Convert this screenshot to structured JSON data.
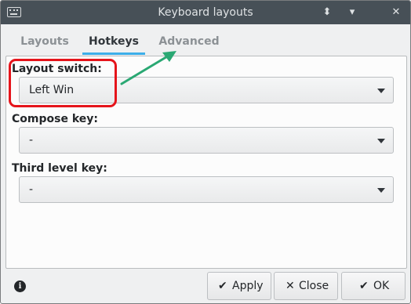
{
  "window": {
    "title": "Keyboard layouts"
  },
  "titlebar": {
    "restore_glyph": "⬍",
    "minimize_glyph": "▾",
    "close_glyph": "✕"
  },
  "tabs": [
    {
      "label": "Layouts",
      "active": false
    },
    {
      "label": "Hotkeys",
      "active": true
    },
    {
      "label": "Advanced",
      "active": false
    }
  ],
  "fields": {
    "layout_switch": {
      "label": "Layout switch:",
      "value": "Left Win"
    },
    "compose_key": {
      "label": "Compose key:",
      "value": "-"
    },
    "third_level_key": {
      "label": "Third level key:",
      "value": "-"
    }
  },
  "buttons": {
    "apply": {
      "label": "Apply",
      "icon": "✔"
    },
    "close": {
      "label": "Close",
      "icon": "✕"
    },
    "ok": {
      "label": "OK",
      "icon": "✔"
    }
  },
  "icons": {
    "info": "i"
  },
  "colors": {
    "titlebar": "#475057",
    "active_tab_underline": "#3daee9",
    "highlight_box": "#e5141b",
    "annotation_arrow": "#2aa873"
  }
}
